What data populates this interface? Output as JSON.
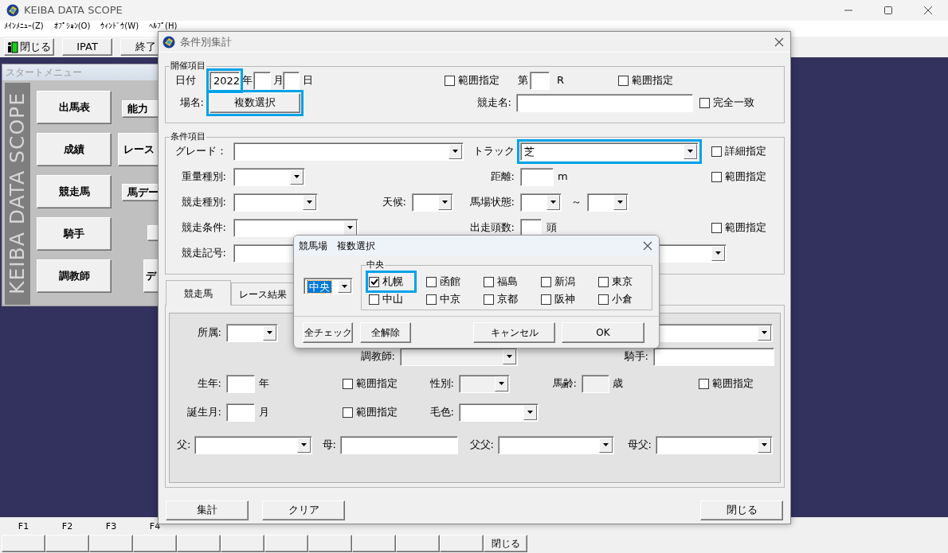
{
  "app": {
    "title": "KEIBA DATA SCOPE"
  },
  "menu": [
    {
      "label": "ﾒｲﾝﾒﾆｭｰ(Z)"
    },
    {
      "label": "ｵﾌﾟｼｮﾝ(O)"
    },
    {
      "label": "ｳｨﾝﾄﾞｳ(W)"
    },
    {
      "label": "ﾍﾙﾌﾟ(H)"
    }
  ],
  "toolbar": [
    {
      "label": "閉じる",
      "kind": "icon"
    },
    {
      "label": "IPAT",
      "kind": "plain"
    },
    {
      "label": "終了",
      "kind": "plain"
    }
  ],
  "start_menu": {
    "title": "スタートメニュー",
    "logo": "KEIBA DATA SCOPE",
    "rows": [
      {
        "label": "出馬表",
        "side": "能力"
      },
      {
        "label": "成績",
        "side": "レース"
      },
      {
        "label": "競走馬",
        "side": "馬デー"
      },
      {
        "label": "騎手"
      },
      {
        "label": "調教師",
        "side": "デ"
      }
    ]
  },
  "function_keys": {
    "labels": [
      "F1",
      "F2",
      "F3",
      "F4"
    ],
    "close_label": "閉じる"
  },
  "dialog": {
    "title": "条件別集計",
    "groups": [
      {
        "legend": "開催項目",
        "rows": [
          {
            "fields": [
              {
                "kind": "label",
                "text": "日付"
              },
              {
                "kind": "input",
                "value": "2022",
                "highlighted": true
              },
              {
                "kind": "text",
                "text": "年"
              },
              {
                "kind": "input"
              },
              {
                "kind": "text",
                "text": "月"
              },
              {
                "kind": "input"
              },
              {
                "kind": "text",
                "text": "日"
              },
              {
                "kind": "check",
                "text": "範囲指定",
                "checked": false
              },
              {
                "kind": "text",
                "text": "第"
              },
              {
                "kind": "input"
              },
              {
                "kind": "text",
                "text": "R"
              },
              {
                "kind": "check",
                "text": "範囲指定",
                "checked": false
              }
            ]
          },
          {
            "fields": [
              {
                "kind": "label",
                "text": "場名:"
              },
              {
                "kind": "button",
                "text": "複数選択",
                "highlighted": true
              },
              {
                "kind": "label",
                "text": "競走名:"
              },
              {
                "kind": "input"
              },
              {
                "kind": "check",
                "text": "完全一致",
                "checked": false
              }
            ]
          }
        ]
      },
      {
        "legend": "条件項目",
        "rows": [
          {
            "fields": [
              {
                "kind": "label",
                "text": "グレード："
              },
              {
                "kind": "combo"
              },
              {
                "kind": "label",
                "text": "トラック"
              },
              {
                "kind": "combo",
                "value": "芝",
                "highlighted": true
              },
              {
                "kind": "check",
                "text": "詳細指定",
                "checked": false
              }
            ]
          },
          {
            "fields": [
              {
                "kind": "label",
                "text": "重量種別:"
              },
              {
                "kind": "combo"
              },
              {
                "kind": "label",
                "text": "距離:"
              },
              {
                "kind": "input"
              },
              {
                "kind": "text",
                "text": "m"
              },
              {
                "kind": "check",
                "text": "範囲指定",
                "checked": false
              }
            ]
          },
          {
            "fields": [
              {
                "kind": "label",
                "text": "競走種別:"
              },
              {
                "kind": "combo"
              },
              {
                "kind": "label",
                "text": "天候:"
              },
              {
                "kind": "combo"
              },
              {
                "kind": "label",
                "text": "馬場状態:"
              },
              {
                "kind": "combo"
              },
              {
                "kind": "text",
                "text": "～"
              },
              {
                "kind": "combo"
              }
            ]
          },
          {
            "fields": [
              {
                "kind": "label",
                "text": "競走条件:"
              },
              {
                "kind": "combo"
              },
              {
                "kind": "label",
                "text": "出走頭数:"
              },
              {
                "kind": "input"
              },
              {
                "kind": "text",
                "text": "頭"
              },
              {
                "kind": "check",
                "text": "範囲指定",
                "checked": false
              }
            ]
          },
          {
            "fields": [
              {
                "kind": "label",
                "text": "競走記号:"
              },
              {
                "kind": "input"
              },
              {
                "kind": "combo"
              }
            ]
          }
        ]
      }
    ],
    "tabs": [
      {
        "label": "競走馬",
        "selected": true
      },
      {
        "label": "レース結果",
        "selected": false
      }
    ],
    "panel_rows": [
      {
        "fields": [
          {
            "kind": "label",
            "text": "所属:"
          },
          {
            "kind": "combo"
          },
          {
            "kind": "combo"
          }
        ]
      },
      {
        "fields": [
          {
            "kind": "label",
            "text": "調教師:"
          },
          {
            "kind": "combo",
            "disabled": true
          },
          {
            "kind": "label",
            "text": "騎手:"
          },
          {
            "kind": "input"
          }
        ]
      },
      {
        "fields": [
          {
            "kind": "label",
            "text": "生年:"
          },
          {
            "kind": "input"
          },
          {
            "kind": "text",
            "text": "年"
          },
          {
            "kind": "check",
            "text": "範囲指定",
            "checked": false
          },
          {
            "kind": "label",
            "text": "性別:"
          },
          {
            "kind": "combo",
            "disabled": true
          },
          {
            "kind": "label",
            "text": "馬齢:"
          },
          {
            "kind": "input",
            "disabled": true
          },
          {
            "kind": "text",
            "text": "歳"
          },
          {
            "kind": "check",
            "text": "範囲指定",
            "checked": false
          }
        ]
      },
      {
        "fields": [
          {
            "kind": "label",
            "text": "誕生月:"
          },
          {
            "kind": "input"
          },
          {
            "kind": "text",
            "text": "月"
          },
          {
            "kind": "check",
            "text": "範囲指定",
            "checked": false
          },
          {
            "kind": "label",
            "text": "毛色:"
          },
          {
            "kind": "combo"
          }
        ]
      },
      {
        "fields": [
          {
            "kind": "label",
            "text": "父:"
          },
          {
            "kind": "combo"
          },
          {
            "kind": "label",
            "text": "母:"
          },
          {
            "kind": "input"
          },
          {
            "kind": "label",
            "text": "父父:"
          },
          {
            "kind": "combo"
          },
          {
            "kind": "label",
            "text": "母父:"
          },
          {
            "kind": "combo"
          }
        ]
      }
    ],
    "buttons": [
      {
        "label": "集計"
      },
      {
        "label": "クリア"
      },
      {
        "label": "閉じる"
      }
    ]
  },
  "popup": {
    "title": "競馬場　複数選択",
    "selector": {
      "value": "中央",
      "focused": true
    },
    "group": "中央",
    "venues": [
      {
        "label": "札幌",
        "checked": true,
        "highlighted": true
      },
      {
        "label": "函館",
        "checked": false
      },
      {
        "label": "福島",
        "checked": false
      },
      {
        "label": "新潟",
        "checked": false
      },
      {
        "label": "東京",
        "checked": false
      },
      {
        "label": "中山",
        "checked": false
      },
      {
        "label": "中京",
        "checked": false
      },
      {
        "label": "京都",
        "checked": false
      },
      {
        "label": "阪神",
        "checked": false
      },
      {
        "label": "小倉",
        "checked": false
      }
    ],
    "buttons": [
      {
        "label": "全チェック"
      },
      {
        "label": "全解除"
      },
      {
        "label": "キャンセル"
      },
      {
        "label": "OK"
      }
    ]
  }
}
